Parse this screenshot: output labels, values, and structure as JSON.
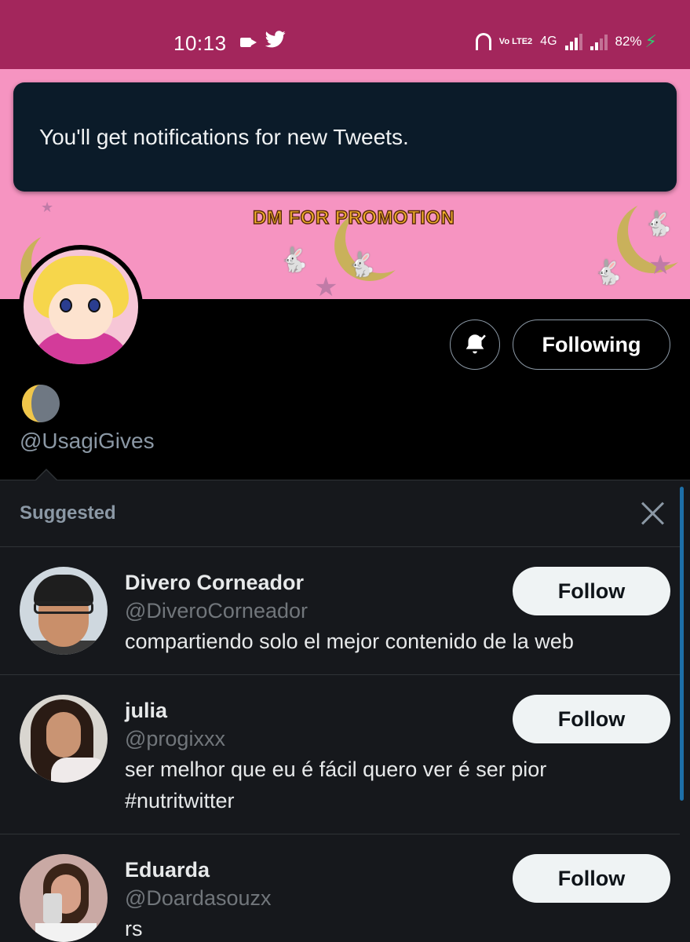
{
  "status_bar": {
    "time": "10:13",
    "network": "4G",
    "volte": "Vo LTE2",
    "battery": "82%"
  },
  "banner": {
    "promo_text": "DM FOR PROMOTION"
  },
  "toast": {
    "message": "You'll get notifications for new Tweets."
  },
  "profile": {
    "handle": "@UsagiGives",
    "following_label": "Following"
  },
  "suggested": {
    "title": "Suggested",
    "users": [
      {
        "name": "Divero Corneador",
        "handle": "@DiveroCorneador",
        "bio": "compartiendo solo el mejor contenido de la web",
        "button": "Follow"
      },
      {
        "name": "julia",
        "handle": "@progixxx",
        "bio": "ser melhor que eu é fácil quero ver é ser pior #nutritwitter",
        "button": "Follow"
      },
      {
        "name": "Eduarda",
        "handle": "@Doardasouzx",
        "bio": "rs",
        "button": "Follow"
      }
    ]
  },
  "colors": {
    "status_bar": "#a3265c",
    "banner": "#f694c1",
    "toast_bg": "#0b1b29",
    "panel_bg": "#16181c"
  }
}
